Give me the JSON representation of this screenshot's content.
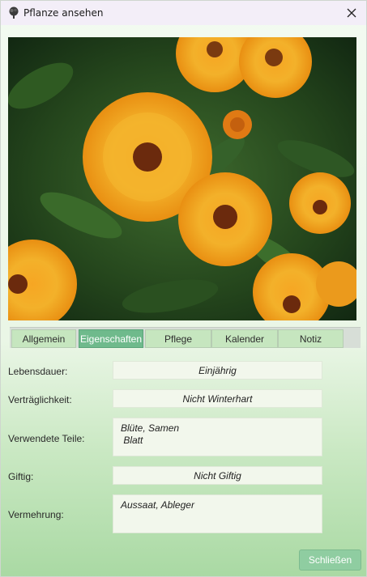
{
  "window": {
    "title": "Pflanze ansehen"
  },
  "photo": {
    "subject": "flower-photo"
  },
  "tabs": [
    {
      "label": "Allgemein",
      "active": false
    },
    {
      "label": "Eigenschaften",
      "active": true
    },
    {
      "label": "Pflege",
      "active": false
    },
    {
      "label": "Kalender",
      "active": false
    },
    {
      "label": "Notiz",
      "active": false
    }
  ],
  "fields": {
    "lebensdauer": {
      "label": "Lebensdauer:",
      "value": "Einjährig"
    },
    "vertraeglichkeit": {
      "label": "Verträglichkeit:",
      "value": "Nicht Winterhart"
    },
    "teile": {
      "label": "Verwendete Teile:",
      "value": "Blüte, Samen\n Blatt"
    },
    "giftig": {
      "label": "Giftig:",
      "value": "Nicht Giftig"
    },
    "vermehrung": {
      "label": "Vermehrung:",
      "value": "Aussaat, Ableger"
    }
  },
  "buttons": {
    "close_label": "Schließen"
  },
  "colors": {
    "accent": "#6fba8c",
    "tab": "#c6e6bf",
    "button": "#8fcda1"
  }
}
